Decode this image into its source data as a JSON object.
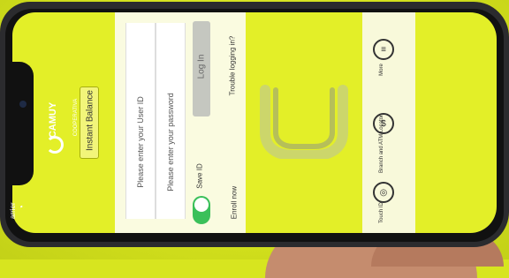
{
  "status": {
    "carrier": "arrier"
  },
  "brand": {
    "name": "CAMUY",
    "tagline": "COOPERATIVA"
  },
  "buttons": {
    "instant_balance": "Instant Balance",
    "login": "Log In"
  },
  "fields": {
    "user_id_placeholder": "Please enter your User ID",
    "password_placeholder": "Please enter your password"
  },
  "links": {
    "trouble": "Trouble logging in?",
    "enroll": "Enroll now"
  },
  "toggle": {
    "save_id_label": "Save ID",
    "on": true
  },
  "bottom_nav": [
    {
      "label": "Touch ID",
      "icon": "fingerprint-icon"
    },
    {
      "label": "Branch and ATM Locator",
      "icon": "dollar-icon"
    },
    {
      "label": "More",
      "icon": "menu-icon"
    }
  ],
  "colors": {
    "accent": "#e3ef28",
    "toggle_on": "#3ac05a"
  }
}
